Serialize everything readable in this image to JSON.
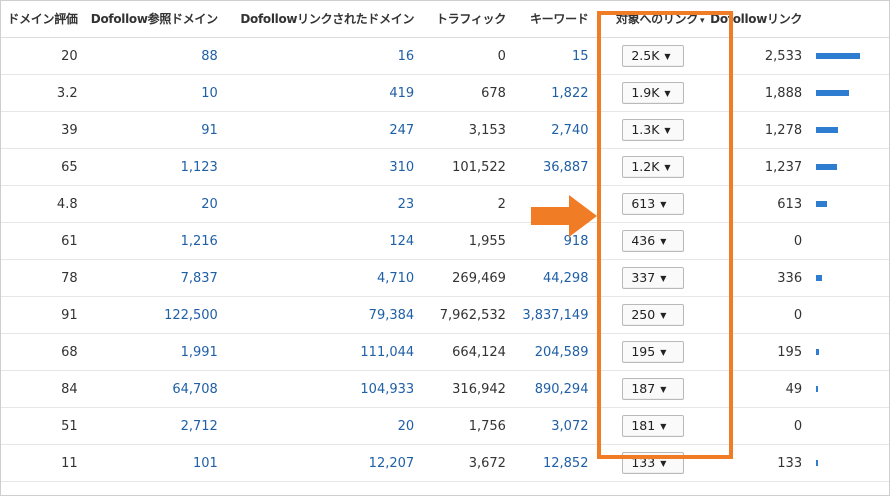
{
  "headers": {
    "domain_rating": "ドメイン評価",
    "dofollow_ref_domains": "Dofollow参照ドメイン",
    "dofollow_linked_domains": "Dofollowリンクされたドメイン",
    "traffic": "トラフィック",
    "keywords": "キーワード",
    "links_to_target": "対象へのリンク",
    "dofollow_links": "Dofollowリンク"
  },
  "sort_caret": "▾",
  "dropdown_caret": "▼",
  "bar_max": 2533,
  "colors": {
    "link": "#1f5fa6",
    "highlight": "#f07c26",
    "bar": "#2e7dd1"
  },
  "rows": [
    {
      "dr": "20",
      "ref": "88",
      "linked": "16",
      "traffic": "0",
      "kw": "15",
      "target": "2.5K",
      "dfl": "2,533",
      "dfl_value": 2533
    },
    {
      "dr": "3.2",
      "ref": "10",
      "linked": "419",
      "traffic": "678",
      "kw": "1,822",
      "target": "1.9K",
      "dfl": "1,888",
      "dfl_value": 1888
    },
    {
      "dr": "39",
      "ref": "91",
      "linked": "247",
      "traffic": "3,153",
      "kw": "2,740",
      "target": "1.3K",
      "dfl": "1,278",
      "dfl_value": 1278
    },
    {
      "dr": "65",
      "ref": "1,123",
      "linked": "310",
      "traffic": "101,522",
      "kw": "36,887",
      "target": "1.2K",
      "dfl": "1,237",
      "dfl_value": 1237
    },
    {
      "dr": "4.8",
      "ref": "20",
      "linked": "23",
      "traffic": "2",
      "kw": "",
      "target": "613",
      "dfl": "613",
      "dfl_value": 613
    },
    {
      "dr": "61",
      "ref": "1,216",
      "linked": "124",
      "traffic": "1,955",
      "kw": "918",
      "target": "436",
      "dfl": "0",
      "dfl_value": 0
    },
    {
      "dr": "78",
      "ref": "7,837",
      "linked": "4,710",
      "traffic": "269,469",
      "kw": "44,298",
      "target": "337",
      "dfl": "336",
      "dfl_value": 336
    },
    {
      "dr": "91",
      "ref": "122,500",
      "linked": "79,384",
      "traffic": "7,962,532",
      "kw": "3,837,149",
      "target": "250",
      "dfl": "0",
      "dfl_value": 0
    },
    {
      "dr": "68",
      "ref": "1,991",
      "linked": "111,044",
      "traffic": "664,124",
      "kw": "204,589",
      "target": "195",
      "dfl": "195",
      "dfl_value": 195
    },
    {
      "dr": "84",
      "ref": "64,708",
      "linked": "104,933",
      "traffic": "316,942",
      "kw": "890,294",
      "target": "187",
      "dfl": "49",
      "dfl_value": 49
    },
    {
      "dr": "51",
      "ref": "2,712",
      "linked": "20",
      "traffic": "1,756",
      "kw": "3,072",
      "target": "181",
      "dfl": "0",
      "dfl_value": 0
    },
    {
      "dr": "11",
      "ref": "101",
      "linked": "12,207",
      "traffic": "3,672",
      "kw": "12,852",
      "target": "133",
      "dfl": "133",
      "dfl_value": 133
    }
  ]
}
